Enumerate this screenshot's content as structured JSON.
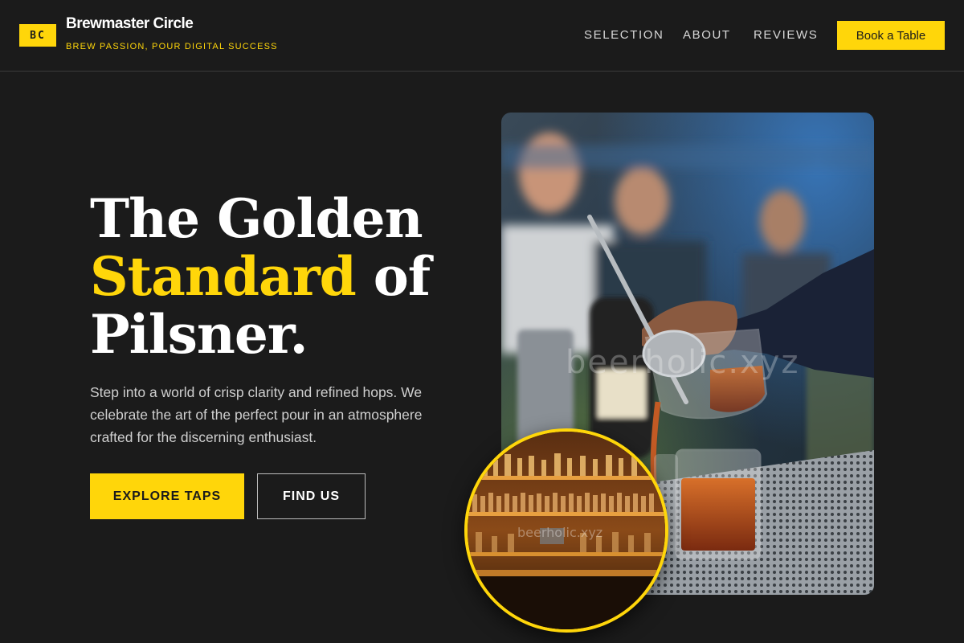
{
  "header": {
    "logo_badge": "BC",
    "brand_name": "Brewmaster Circle",
    "tagline": "BREW PASSION, POUR DIGITAL SUCCESS",
    "nav": {
      "selection": "SELECTION",
      "about": "ABOUT",
      "reviews": "REVIEWS"
    },
    "cta_label": "Book a Table"
  },
  "hero": {
    "title_line1": "The Golden",
    "title_accent": "Standard",
    "title_of": "of",
    "title_line3": "Pilsner.",
    "description": "Step into a world of crisp clarity and refined hops. We celebrate the art of the perfect pour in an atmosphere crafted for the discerning enthusiast.",
    "primary_button": "EXPLORE TAPS",
    "secondary_button": "FIND US",
    "photo_watermark": "beerholic.xyz",
    "inset_watermark": "beerholic.xyz"
  },
  "colors": {
    "background": "#1b1b1b",
    "accent": "#ffd60a",
    "text": "#ffffff",
    "muted_text": "#cfcfcf"
  }
}
